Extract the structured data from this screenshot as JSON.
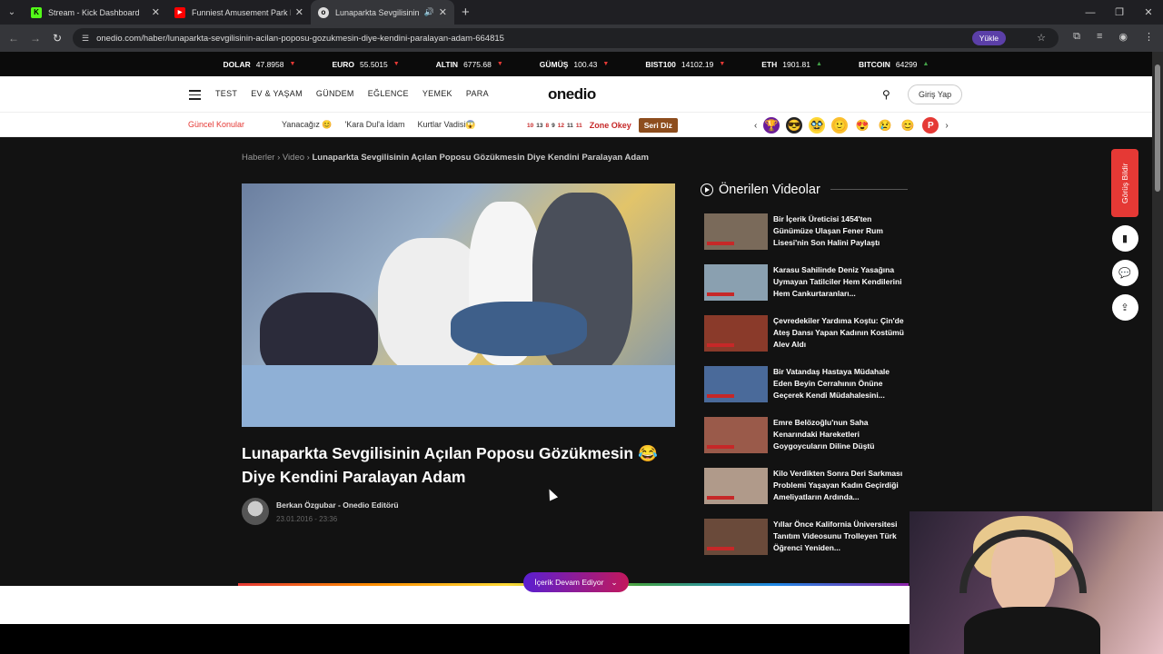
{
  "browser": {
    "tabs": [
      {
        "title": "Stream - Kick Dashboard",
        "favicon": "K",
        "fav_color": "#53fc18"
      },
      {
        "title": "Funniest Amusement Park Fails",
        "favicon": "▶",
        "fav_color": "#ff0000"
      },
      {
        "title": "Lunaparkta Sevgilisinin Açıl",
        "favicon": "o",
        "fav_color": "#dddddd"
      }
    ],
    "url": "onedio.com/haber/lunaparkta-sevgilisinin-acilan-poposu-gozukmesin-diye-kendini-paralayan-adam-664815",
    "update_label": "Yükle"
  },
  "ticker": [
    {
      "name": "DOLAR",
      "value": "47.8958",
      "dir": "down"
    },
    {
      "name": "EURO",
      "value": "55.5015",
      "dir": "down"
    },
    {
      "name": "ALTIN",
      "value": "6775.68",
      "dir": "down"
    },
    {
      "name": "GÜMÜŞ",
      "value": "100.43",
      "dir": "down"
    },
    {
      "name": "BIST100",
      "value": "14102.19",
      "dir": "down"
    },
    {
      "name": "ETH",
      "value": "1901.81",
      "dir": "up"
    },
    {
      "name": "BITCOIN",
      "value": "64299",
      "dir": "up"
    }
  ],
  "site": {
    "logo": "onedio",
    "nav": [
      "TEST",
      "EV & YAŞAM",
      "GÜNDEM",
      "EĞLENCE",
      "YEMEK",
      "PARA"
    ],
    "login": "Giriş Yap",
    "topics_heading": "Güncel Konular",
    "topics": [
      "Yanacağız 😊",
      "'Kara Dul'a İdam",
      "Kurtlar Vadisi😱"
    ],
    "zone_numbers": [
      "10",
      "13",
      "8",
      "9",
      "12",
      "11",
      "11"
    ],
    "zone_title": "Zone Okey",
    "zone_button": "Seri Diz",
    "emojis": [
      "🏆",
      "😎",
      "🥸",
      "🙂",
      "😍",
      "😢",
      "😊",
      "P"
    ]
  },
  "article": {
    "breadcrumb": [
      "Haberler",
      "Video"
    ],
    "breadcrumb_current": "Lunaparkta Sevgilisinin Açılan Poposu Gözükmesin Diye Kendini Paralayan Adam",
    "title": "Lunaparkta Sevgilisinin Açılan Poposu Gözükmesin 😂 Diye Kendini Paralayan Adam",
    "author": "Berkan Özgubar - Onedio Editörü",
    "date": "23.01.2016 - 23:36",
    "continue_label": "İçerik Devam Ediyor",
    "feedback_label": "Görüş Bildir"
  },
  "recommended": {
    "heading": "Önerilen Videolar",
    "items": [
      {
        "title": "Bir İçerik Üreticisi 1454'ten Günümüze Ulaşan Fener Rum Lisesi'nin Son Halini Paylaştı",
        "color": "#7a6a5a"
      },
      {
        "title": "Karasu Sahilinde Deniz Yasağına Uymayan Tatilciler Hem Kendilerini Hem Cankurtaranları...",
        "color": "#8aa0b0"
      },
      {
        "title": "Çevredekiler Yardıma Koştu: Çin'de Ateş Dansı Yapan Kadının Kostümü Alev Aldı",
        "color": "#8a3a2a"
      },
      {
        "title": "Bir Vatandaş Hastaya Müdahale Eden Beyin Cerrahının Önüne Geçerek Kendi Müdahalesini...",
        "color": "#4a6a9a"
      },
      {
        "title": "Emre Belözoğlu'nun Saha Kenarındaki Hareketleri Goygoycuların Diline Düştü",
        "color": "#9a5a4a"
      },
      {
        "title": "Kilo Verdikten Sonra Deri Sarkması Problemi Yaşayan Kadın Geçirdiği Ameliyatların Ardında...",
        "color": "#b09a8a"
      },
      {
        "title": "Yıllar Önce Kalifornia Üniversitesi Tanıtım Videosunu Trolleyen Türk Öğrenci Yeniden...",
        "color": "#6a4a3a"
      }
    ]
  }
}
